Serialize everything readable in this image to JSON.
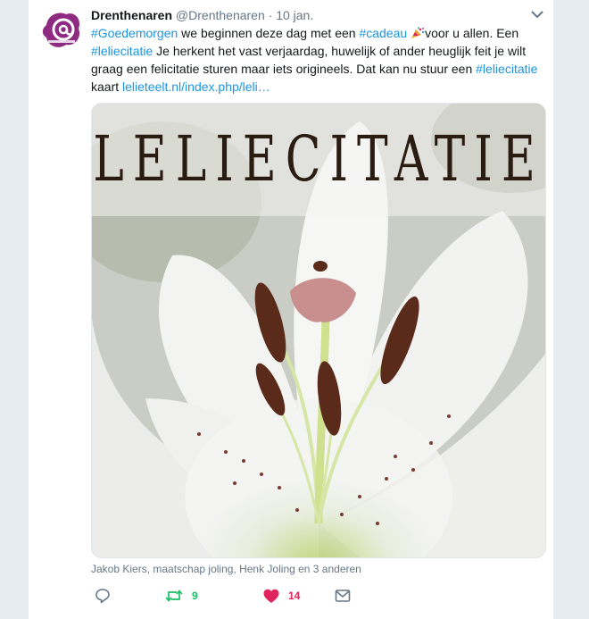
{
  "tweet": {
    "author_name": "Drenthenaren",
    "author_handle": "@Drenthenaren",
    "separator": "·",
    "timestamp": "10 jan.",
    "text": {
      "hashtag_1": "#Goedemorgen",
      "part_1": " we beginnen deze dag met een ",
      "hashtag_2": "#cadeau",
      "part_2": "voor u allen. Een",
      "hashtag_3": "#leliecitatie",
      "part_3": " Je herkent het vast verjaardag, huwelijk of ander heuglijk feit je wilt graag een felicitatie sturen maar  iets origineels. Dat kan nu stuur een ",
      "hashtag_4": "#leliecitatie",
      "part_4": "kaart ",
      "link": "lelieteelt.nl/index.php/leli…"
    },
    "media": {
      "overlay_title": "LELIECITATIE"
    },
    "tagged_people": "Jakob Kiers, maatschap joling, Henk Joling en 3 anderen",
    "actions": {
      "reply_icon": "reply-icon",
      "retweet_icon": "retweet-icon",
      "retweet_count": "9",
      "like_icon": "heart-icon",
      "like_count": "14",
      "dm_icon": "envelope-icon"
    }
  },
  "colors": {
    "background": "#e6ecf0",
    "link": "#1b95e0",
    "retweet": "#17bf63",
    "like": "#e0245e",
    "muted": "#657786",
    "avatar_purple": "#8e2a80"
  }
}
